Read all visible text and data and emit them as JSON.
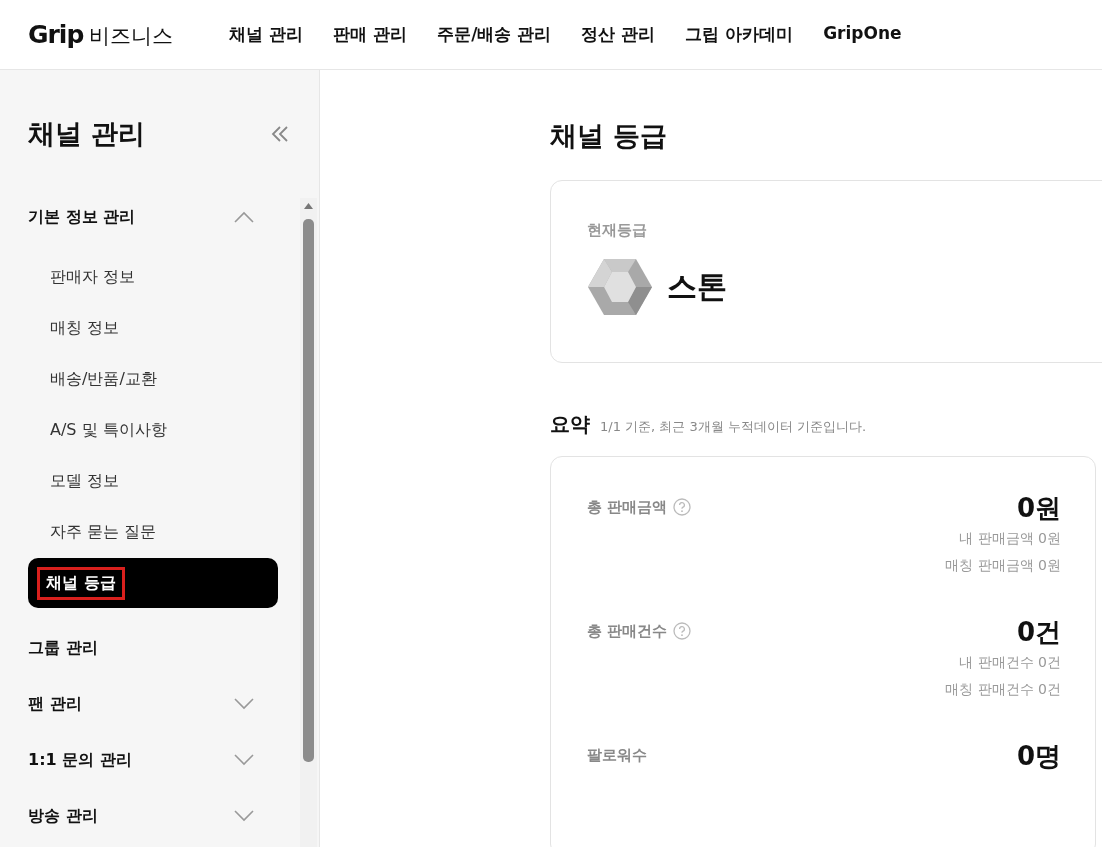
{
  "header": {
    "logo": {
      "brand": "Grip",
      "suffix": "비즈니스"
    },
    "nav": [
      {
        "label": "채널 관리"
      },
      {
        "label": "판매 관리"
      },
      {
        "label": "주문/배송 관리"
      },
      {
        "label": "정산 관리"
      },
      {
        "label": "그립 아카데미"
      },
      {
        "label": "GripOne"
      }
    ]
  },
  "sidebar": {
    "title": "채널 관리",
    "groups": [
      {
        "label": "기본 정보 관리",
        "expanded": true,
        "children": [
          {
            "label": "판매자 정보",
            "selected": false,
            "highlighted": false
          },
          {
            "label": "매칭 정보",
            "selected": false,
            "highlighted": false
          },
          {
            "label": "배송/반품/교환",
            "selected": false,
            "highlighted": false
          },
          {
            "label": "A/S 및 특이사항",
            "selected": false,
            "highlighted": false
          },
          {
            "label": "모델 정보",
            "selected": false,
            "highlighted": false
          },
          {
            "label": "자주 묻는 질문",
            "selected": false,
            "highlighted": false
          },
          {
            "label": "채널 등급",
            "selected": true,
            "highlighted": true
          }
        ]
      },
      {
        "label": "그룹 관리"
      },
      {
        "label": "팬 관리",
        "expanded": false
      },
      {
        "label": "1:1 문의 관리",
        "expanded": false
      },
      {
        "label": "방송 관리",
        "expanded": false
      }
    ]
  },
  "main": {
    "title": "채널 등급",
    "grade": {
      "caption": "현재등급",
      "name": "스톤"
    },
    "summary": {
      "title": "요약",
      "note": "1/1 기준, 최근 3개월 누적데이터 기준입니다.",
      "metrics": [
        {
          "label": "총 판매금액",
          "help": true,
          "value": "0원",
          "details": [
            "내 판매금액 0원",
            "매칭 판매금액 0원"
          ]
        },
        {
          "label": "총 판매건수",
          "help": true,
          "value": "0건",
          "details": [
            "내 판매건수 0건",
            "매칭 판매건수 0건"
          ]
        },
        {
          "label": "팔로워수",
          "help": false,
          "value": "0명"
        }
      ]
    }
  }
}
